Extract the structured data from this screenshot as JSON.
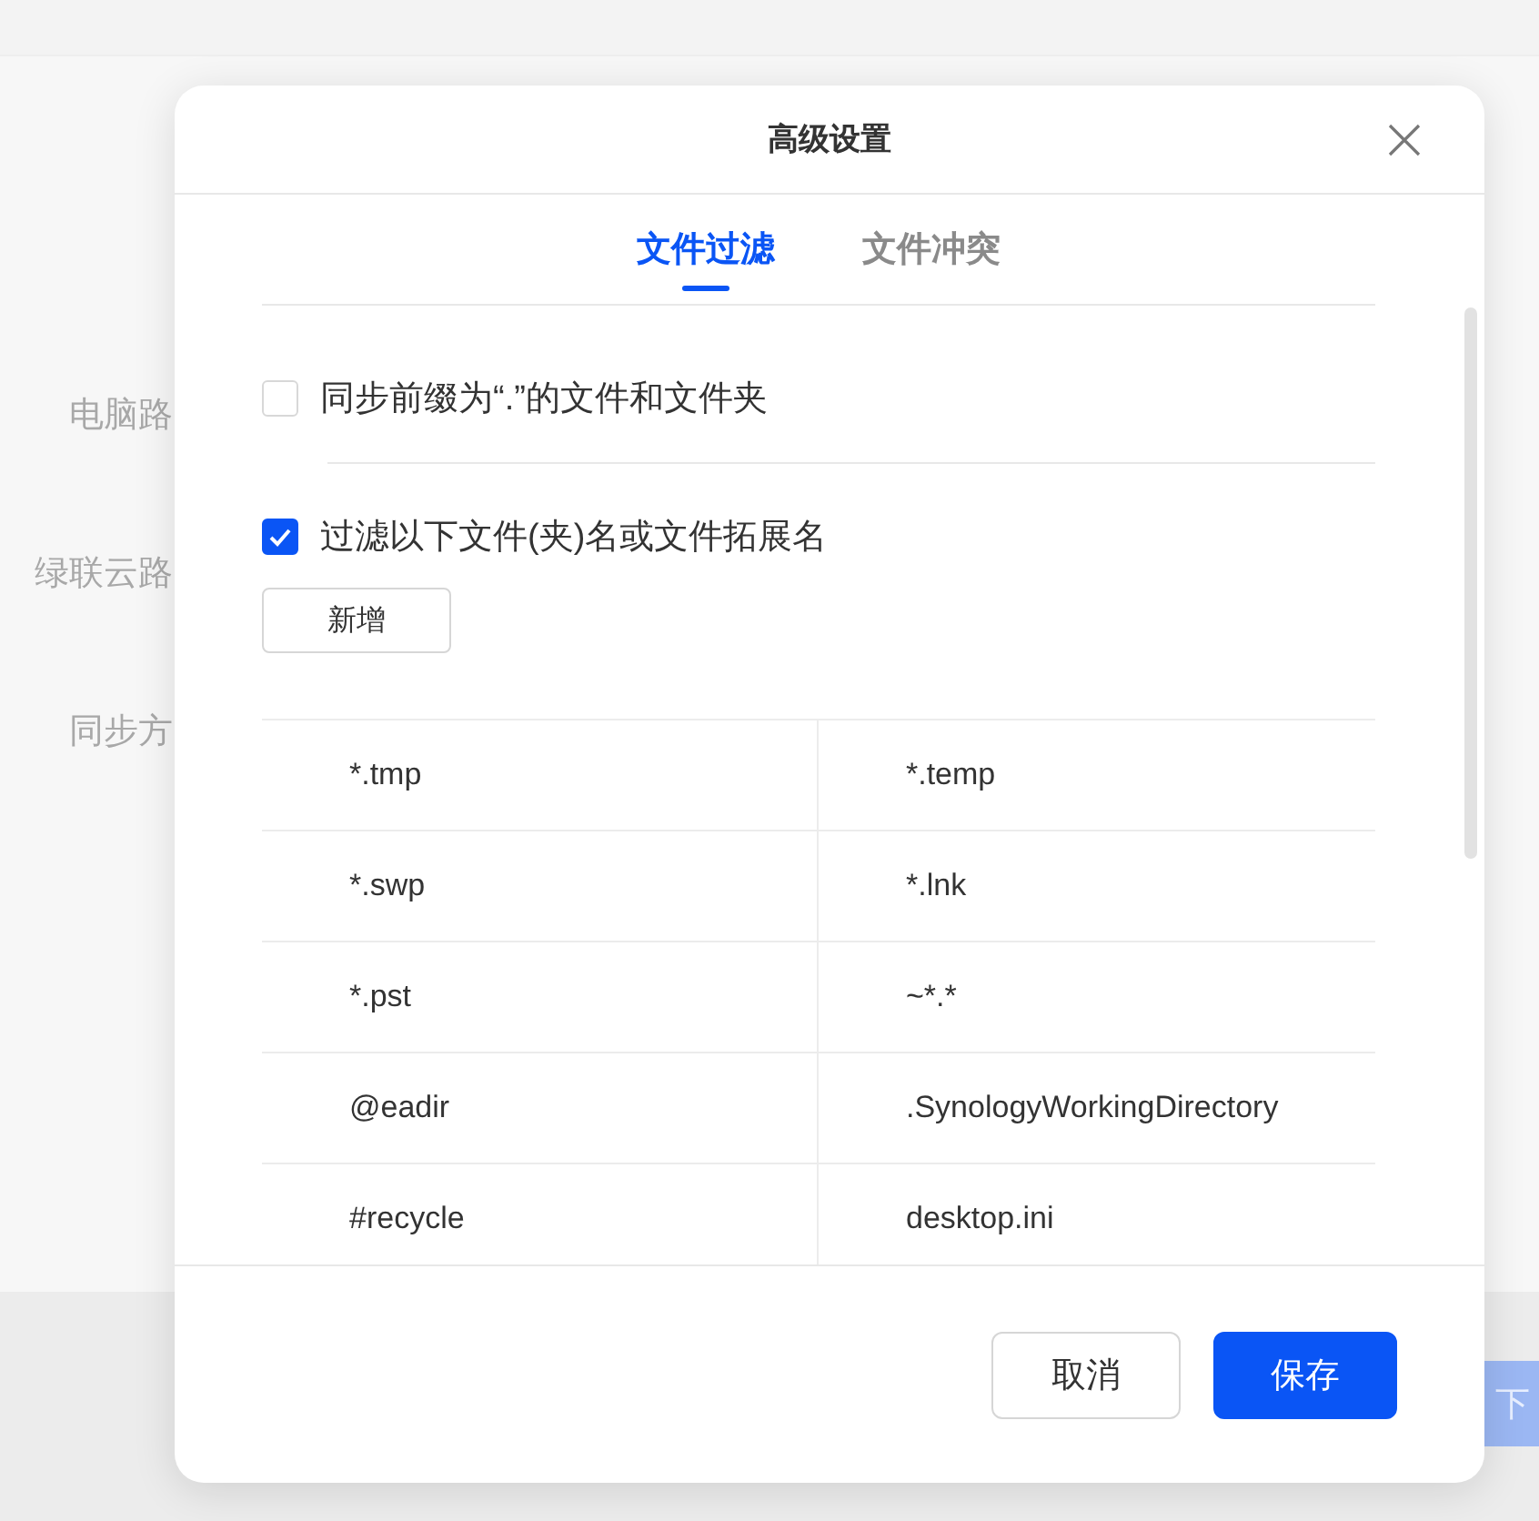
{
  "background": {
    "labels": [
      "电脑路",
      "绿联云路",
      "同步方"
    ],
    "button": "下"
  },
  "dialog": {
    "title": "高级设置",
    "tabs": [
      {
        "label": "文件过滤",
        "selected": true
      },
      {
        "label": "文件冲突",
        "selected": false
      }
    ],
    "options": [
      {
        "label": "同步前缀为“.”的文件和文件夹",
        "checked": false
      },
      {
        "label": "过滤以下文件(夹)名或文件拓展名",
        "checked": true
      }
    ],
    "add_button": "新增",
    "filters": [
      [
        "*.tmp",
        "*.temp"
      ],
      [
        "*.swp",
        "*.lnk"
      ],
      [
        "*.pst",
        "~*.*"
      ],
      [
        "@eadir",
        ".SynologyWorkingDirectory"
      ],
      [
        "#recycle",
        "desktop.ini"
      ]
    ],
    "buttons": [
      {
        "label": "取消",
        "primary": false
      },
      {
        "label": "保存",
        "primary": true
      }
    ]
  }
}
